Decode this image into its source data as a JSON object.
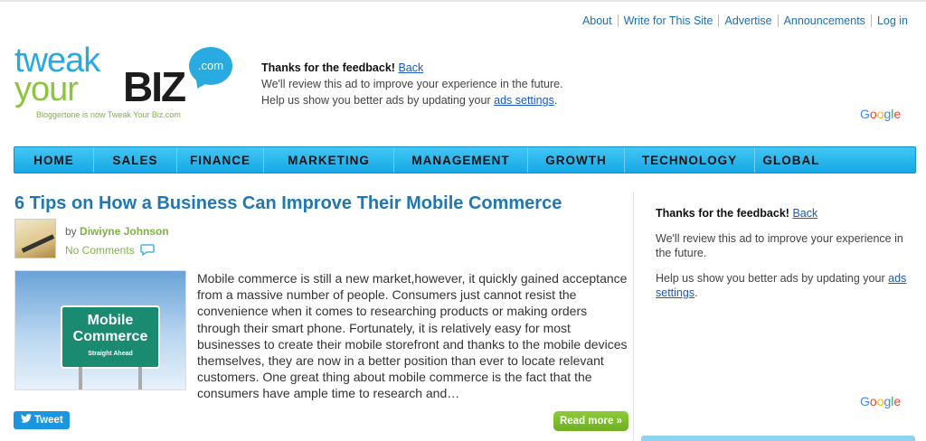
{
  "top_links": [
    "About",
    "Write for This Site",
    "Advertise",
    "Announcements",
    "Log in"
  ],
  "logo": {
    "line1": "tweak",
    "line2": "your",
    "biz": "BIZ",
    "dotcom": ".com",
    "tagline": "Bloggertone is now Tweak Your Biz.com"
  },
  "header_ad": {
    "title": "Thanks for the feedback!",
    "back_link": "Back",
    "line1": "We'll review this ad to improve your experience in the future.",
    "line2_prefix": "Help us show you better ads by updating your",
    "settings_link": "ads settings",
    "line2_suffix": ".",
    "google": [
      "G",
      "o",
      "o",
      "g",
      "l",
      "e"
    ]
  },
  "nav": [
    "HOME",
    "SALES",
    "FINANCE",
    "MARKETING",
    "MANAGEMENT",
    "GROWTH",
    "TECHNOLOGY",
    "GLOBAL"
  ],
  "article": {
    "title": "6 Tips on How a Business Can Improve Their Mobile Commerce",
    "by": "by",
    "author": "Diwiyne Johnson",
    "comments": "No Comments",
    "image_sign_line1": "Mobile",
    "image_sign_line2": "Commerce",
    "image_sign_sub": "Straight Ahead",
    "excerpt": "Mobile commerce is still a new market,however, it quickly gained acceptance from a massive number of people. Consumers just cannot resist the convenience when it comes to researching products or making orders through their smart phone. Fortunately, it is relatively easy for most businesses to create their mobile storefront and thanks to the mobile devices themselves, they are now in a better position than ever to locate relevant customers. One great thing about mobile commerce is the fact that the consumers have ample time to research and…",
    "tweet_label": "Tweet",
    "readmore_label": "Read more »"
  },
  "sidebar_ad": {
    "title": "Thanks for the feedback!",
    "back_link": "Back",
    "line1": "We'll review this ad to improve your experience in the future.",
    "line2_prefix": "Help us show you better ads by updating your",
    "settings_link": "ads settings",
    "line2_suffix": ".",
    "google": [
      "G",
      "o",
      "o",
      "g",
      "l",
      "e"
    ]
  },
  "colors": {
    "brand_blue": "#2aa9e0",
    "brand_green": "#8cc63f",
    "nav_blue": "#15a8e6",
    "title_blue": "#1f78b4",
    "readmore_green": "#6fae24"
  }
}
